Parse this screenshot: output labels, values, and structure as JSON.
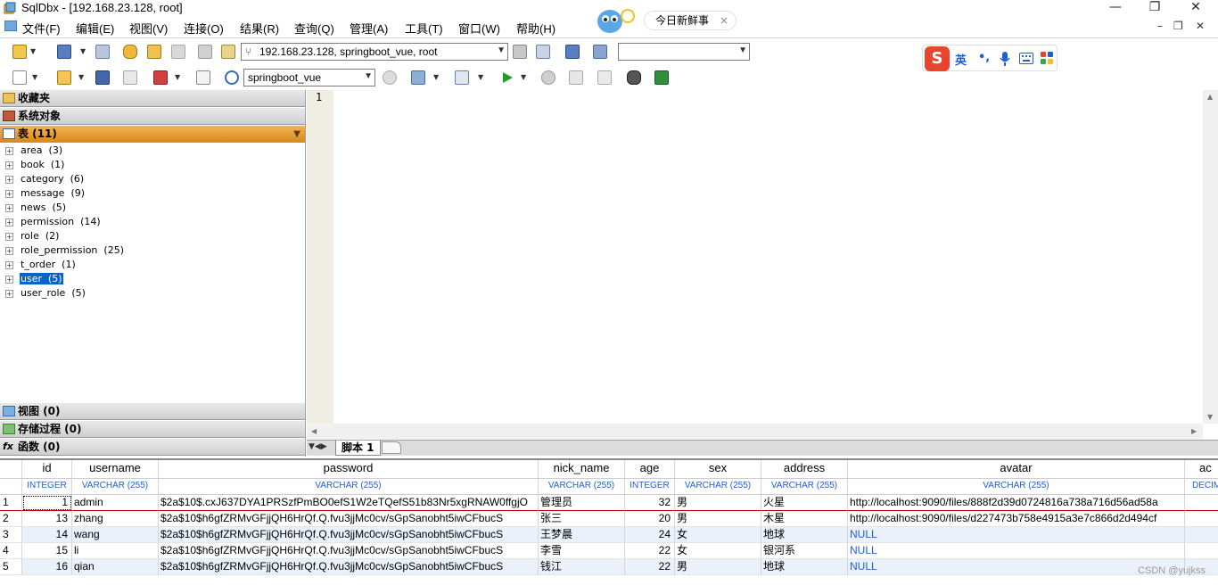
{
  "window": {
    "title": "SqlDbx - [192.168.23.128, root]",
    "controls": {
      "minimize": "—",
      "restore": "❐",
      "close": "✕"
    }
  },
  "menu": [
    {
      "label": "文件(F)"
    },
    {
      "label": "编辑(E)"
    },
    {
      "label": "视图(V)"
    },
    {
      "label": "连接(O)"
    },
    {
      "label": "结果(R)"
    },
    {
      "label": "查询(Q)"
    },
    {
      "label": "管理(A)"
    },
    {
      "label": "工具(T)"
    },
    {
      "label": "窗口(W)"
    },
    {
      "label": "帮助(H)"
    }
  ],
  "notification": {
    "text": "今日新鲜事",
    "close": "×"
  },
  "mdi_controls": {
    "minimize": "–",
    "restore": "❐",
    "close": "✕"
  },
  "toolbar1": {
    "connection": "192.168.23.128, springboot_vue, root",
    "filter": ""
  },
  "toolbar2": {
    "database": "springboot_vue"
  },
  "ime": {
    "logo": "S",
    "lang": "英"
  },
  "left_panel": {
    "favorites": "收藏夹",
    "system_objects": "系统对象",
    "tables_header": "表 (11)",
    "tables": [
      {
        "name": "area",
        "count": "(3)"
      },
      {
        "name": "book",
        "count": "(1)"
      },
      {
        "name": "category",
        "count": "(6)"
      },
      {
        "name": "message",
        "count": "(9)"
      },
      {
        "name": "news",
        "count": "(5)"
      },
      {
        "name": "permission",
        "count": "(14)"
      },
      {
        "name": "role",
        "count": "(2)"
      },
      {
        "name": "role_permission",
        "count": "(25)"
      },
      {
        "name": "t_order",
        "count": "(1)"
      },
      {
        "name": "user",
        "count": "(5)"
      },
      {
        "name": "user_role",
        "count": "(5)"
      }
    ],
    "views_header": "视图 (0)",
    "procs_header": "存储过程 (0)",
    "funcs_header": "函数 (0)"
  },
  "editor": {
    "line_number": "1"
  },
  "tabs": {
    "script_tab": "脚本 1"
  },
  "grid": {
    "columns": [
      {
        "name": "id",
        "type": "INTEGER"
      },
      {
        "name": "username",
        "type": "VARCHAR (255)"
      },
      {
        "name": "password",
        "type": "VARCHAR (255)"
      },
      {
        "name": "nick_name",
        "type": "VARCHAR (255)"
      },
      {
        "name": "age",
        "type": "INTEGER"
      },
      {
        "name": "sex",
        "type": "VARCHAR (255)"
      },
      {
        "name": "address",
        "type": "VARCHAR (255)"
      },
      {
        "name": "avatar",
        "type": "VARCHAR (255)"
      },
      {
        "name": "ac",
        "type": "DECIM"
      }
    ],
    "rows": [
      {
        "n": "1",
        "id": "1",
        "username": "admin",
        "password": "$2a$10$.cxJ637DYA1PRSzfPmBO0efS1W2eTQefS51b83Nr5xgRNAW0ffgjO",
        "nick_name": "管理员",
        "age": "32",
        "sex": "男",
        "address": "火星",
        "avatar": "http://localhost:9090/files/888f2d39d0724816a738a716d56ad58a"
      },
      {
        "n": "2",
        "id": "13",
        "username": "zhang",
        "password": "$2a$10$h6gfZRMvGFjjQH6HrQf.Q.fvu3jjMc0cv/sGpSanobht5iwCFbucS",
        "nick_name": "张三",
        "age": "20",
        "sex": "男",
        "address": "木星",
        "avatar": "http://localhost:9090/files/d227473b758e4915a3e7c866d2d494cf"
      },
      {
        "n": "3",
        "id": "14",
        "username": "wang",
        "password": "$2a$10$h6gfZRMvGFjjQH6HrQf.Q.fvu3jjMc0cv/sGpSanobht5iwCFbucS",
        "nick_name": "王梦晨",
        "age": "24",
        "sex": "女",
        "address": "地球",
        "avatar": "NULL"
      },
      {
        "n": "4",
        "id": "15",
        "username": "li",
        "password": "$2a$10$h6gfZRMvGFjjQH6HrQf.Q.fvu3jjMc0cv/sGpSanobht5iwCFbucS",
        "nick_name": "李雪",
        "age": "22",
        "sex": "女",
        "address": "银河系",
        "avatar": "NULL"
      },
      {
        "n": "5",
        "id": "16",
        "username": "qian",
        "password": "$2a$10$h6gfZRMvGFjjQH6HrQf.Q.fvu3jjMc0cv/sGpSanobht5iwCFbucS",
        "nick_name": "钱江",
        "age": "22",
        "sex": "男",
        "address": "地球",
        "avatar": "NULL"
      }
    ]
  },
  "watermark": "CSDN @yujkss",
  "colors": {
    "accent": "#0a64c8",
    "tables_header": "#e09a2c",
    "null": "#1f5fd0"
  }
}
